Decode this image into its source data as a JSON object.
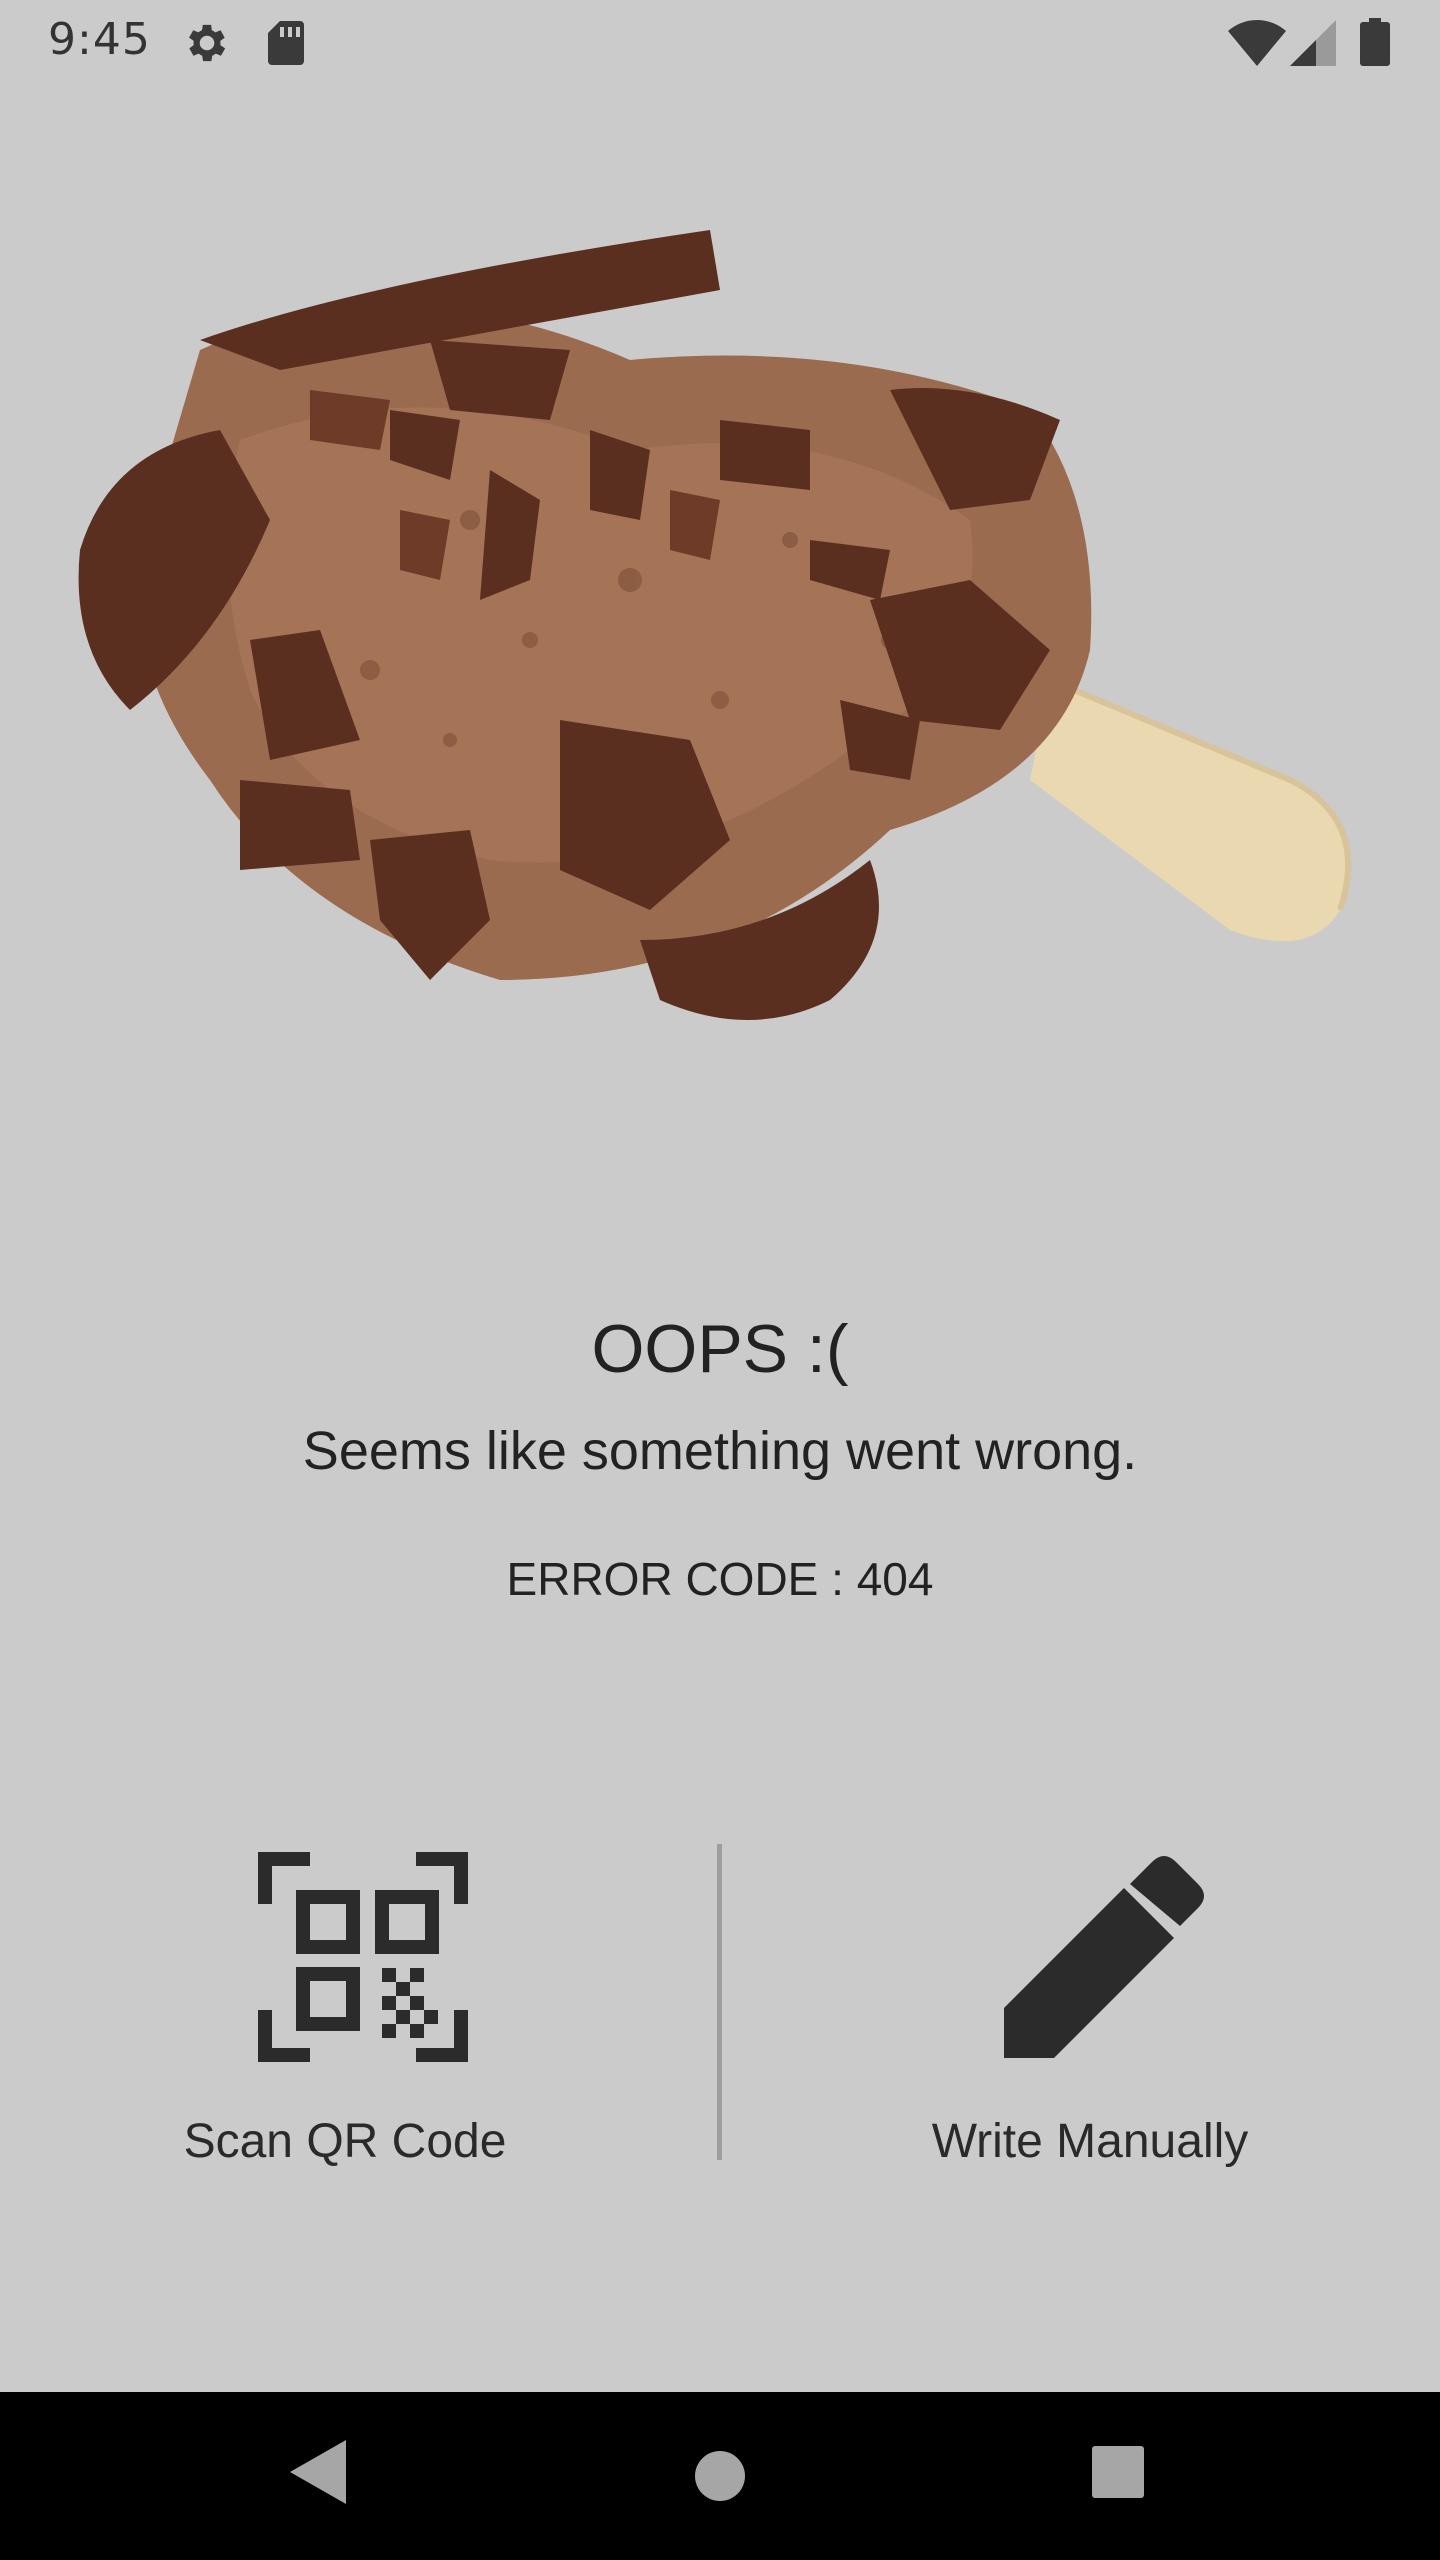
{
  "status_bar": {
    "time": "9:45",
    "icons": [
      "gear-icon",
      "sd-card-icon",
      "wifi-icon",
      "signal-icon",
      "battery-icon"
    ]
  },
  "illustration": {
    "subject": "broken-chocolate-ice-cream-bar"
  },
  "message": {
    "title": "OOPS :(",
    "subtitle": "Seems like something went wrong.",
    "error_code": "ERROR CODE : 404"
  },
  "actions": {
    "scan": {
      "label": "Scan QR Code",
      "icon": "qr-code-icon"
    },
    "manual": {
      "label": "Write Manually",
      "icon": "pencil-icon"
    }
  },
  "nav_bar": {
    "icons": [
      "back-icon",
      "home-icon",
      "recents-icon"
    ]
  },
  "colors": {
    "background": "#cbcbcb",
    "text": "#222222",
    "icon": "#2b2b2b",
    "nav_background": "#000000",
    "nav_icon": "#a6a6a6"
  }
}
